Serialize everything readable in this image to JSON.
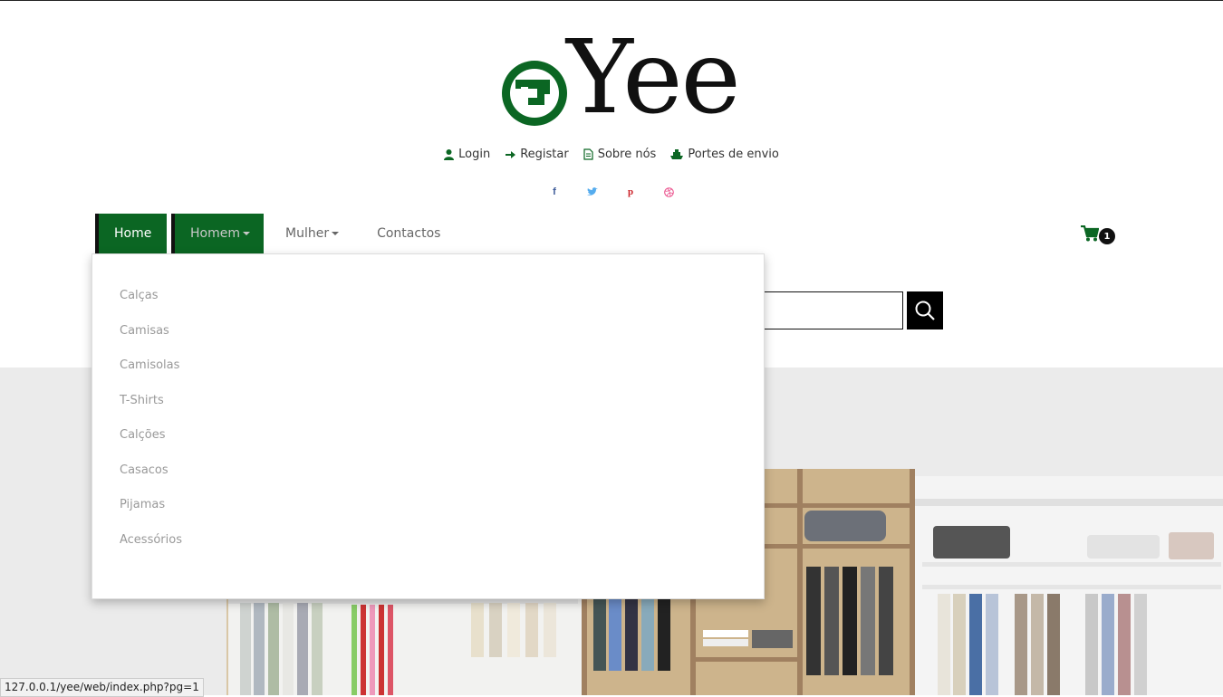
{
  "brand": {
    "name": "Yee"
  },
  "top_links": [
    {
      "label": "Login",
      "icon": "user-icon"
    },
    {
      "label": "Registar",
      "icon": "arrow-right-icon"
    },
    {
      "label": "Sobre nós",
      "icon": "document-icon"
    },
    {
      "label": "Portes de envio",
      "icon": "ship-icon"
    }
  ],
  "social": [
    "facebook-icon",
    "twitter-icon",
    "pinterest-icon",
    "dribbble-icon"
  ],
  "nav": {
    "home": "Home",
    "homem": "Homem",
    "mulher": "Mulher",
    "contactos": "Contactos"
  },
  "cart": {
    "count": "1"
  },
  "dropdown": {
    "items": [
      "Calças",
      "Camisas",
      "Camisolas",
      "T-Shirts",
      "Calções",
      "Casacos",
      "Pijamas",
      "Acessórios"
    ]
  },
  "status_bar": {
    "url": "127.0.0.1/yee/web/index.php?pg=1"
  },
  "colors": {
    "brand_green": "#0b6623",
    "black": "#000000"
  }
}
